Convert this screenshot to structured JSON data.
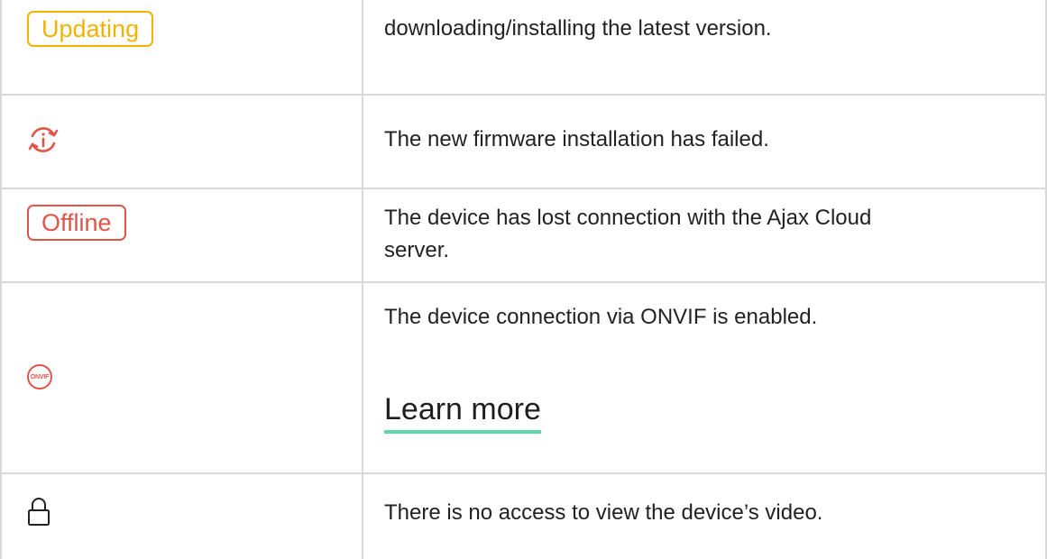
{
  "rows": [
    {
      "badge": "Updating",
      "description": "downloading/installing the latest version."
    },
    {
      "icon": "firmware-failed-icon",
      "description": "The new firmware installation has failed."
    },
    {
      "badge": "Offline",
      "description_line1": "The device has lost connection with the Ajax Cloud",
      "description_line2": "server."
    },
    {
      "icon_text": "ONVIF",
      "description": "The device connection via ONVIF is enabled.",
      "link": "Learn more"
    },
    {
      "icon": "lock-icon",
      "description": "There is no access to view the device’s video."
    }
  ],
  "colors": {
    "updating": "#f2b200",
    "offline": "#e0554a",
    "link_underline": "#5ed8a6",
    "border": "#d9d9d9"
  }
}
